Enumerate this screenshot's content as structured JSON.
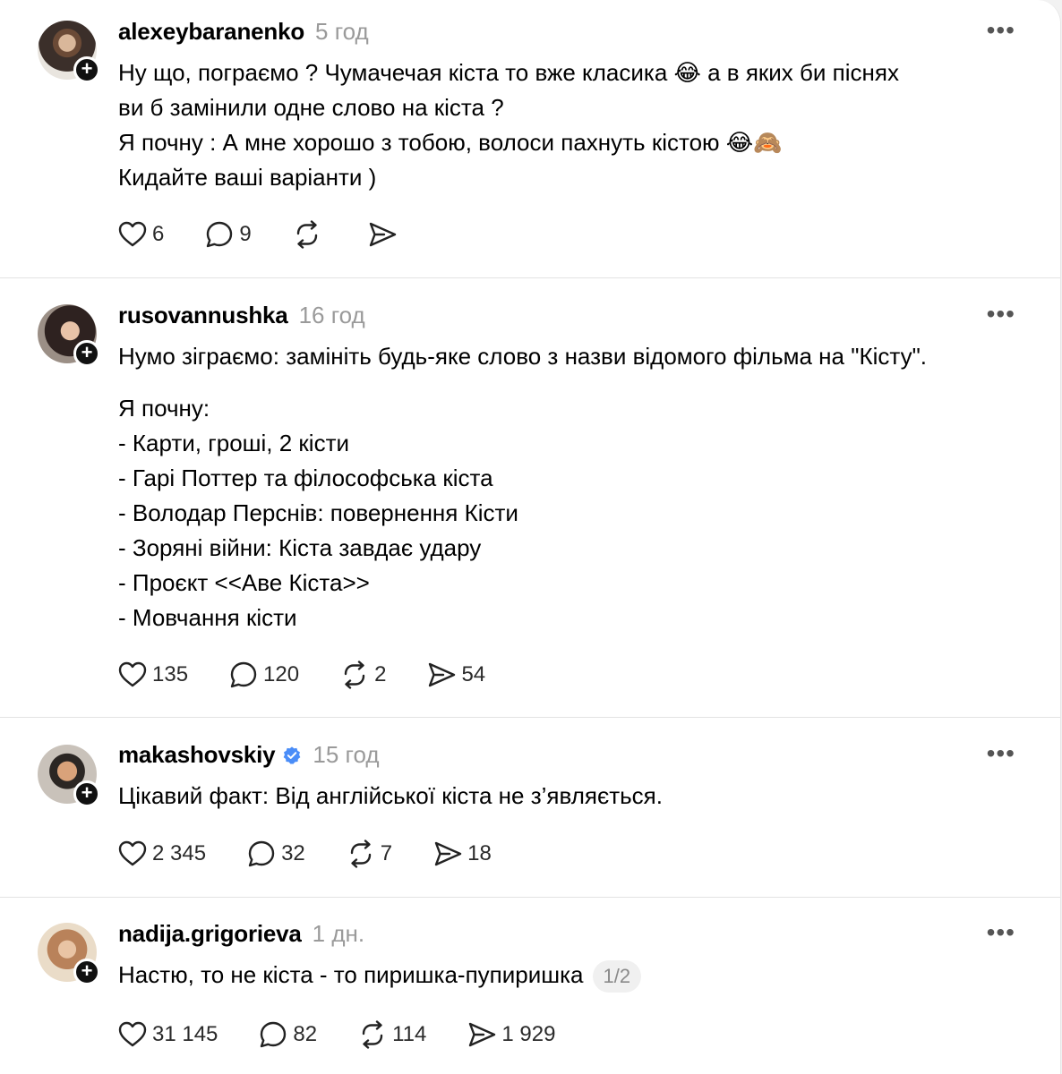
{
  "posts": [
    {
      "username": "alexeybaranenko",
      "verified": false,
      "time": "5 год",
      "lines": [
        "Ну що, пограємо ? Чумачечая кіста то вже класика 😂 а в яких би піснях",
        "ви б замінили одне слово на кіста ?",
        "Я почну : А мне хорошо з тобою, волоси пахнуть кістою 😂🙈",
        "Кидайте ваші варіанти )"
      ],
      "likes": "6",
      "replies": "9",
      "reposts": "",
      "shares": ""
    },
    {
      "username": "rusovannushka",
      "verified": false,
      "time": "16 год",
      "lines": [
        "Нумо зіграємо: замініть будь-яке слово з назви відомого фільма на \"Кісту\".",
        "",
        "Я почну:",
        "- Карти, гроші, 2 кісти",
        "- Гарі Поттер та філософська кіста",
        "- Володар Перснів: повернення Кісти",
        "- Зоряні війни: Кіста завдає удару",
        "- Проєкт <<Аве Кіста>>",
        "- Мовчання кісти"
      ],
      "likes": "135",
      "replies": "120",
      "reposts": "2",
      "shares": "54"
    },
    {
      "username": "makashovskiy",
      "verified": true,
      "time": "15 год",
      "lines": [
        "Цікавий факт: Від англійської кіста не з’являється."
      ],
      "likes": "2 345",
      "replies": "32",
      "reposts": "7",
      "shares": "18"
    },
    {
      "username": "nadija.grigorieva",
      "verified": false,
      "time": "1 дн.",
      "lines": [
        "Настю, то не кіста - то пиришка-пупиришка"
      ],
      "pager": "1/2",
      "likes": "31 145",
      "replies": "82",
      "reposts": "114",
      "shares": "1 929"
    }
  ],
  "ui": {
    "more_label": "•••",
    "plus_label": "+",
    "icons": [
      "heart-icon",
      "comment-icon",
      "repost-icon",
      "share-icon",
      "verified-badge-icon",
      "more-icon",
      "follow-plus-icon"
    ],
    "colors": {
      "verified": "#4a8df8",
      "muted_text": "#9a9a9a",
      "divider": "#e3e3e3"
    }
  }
}
